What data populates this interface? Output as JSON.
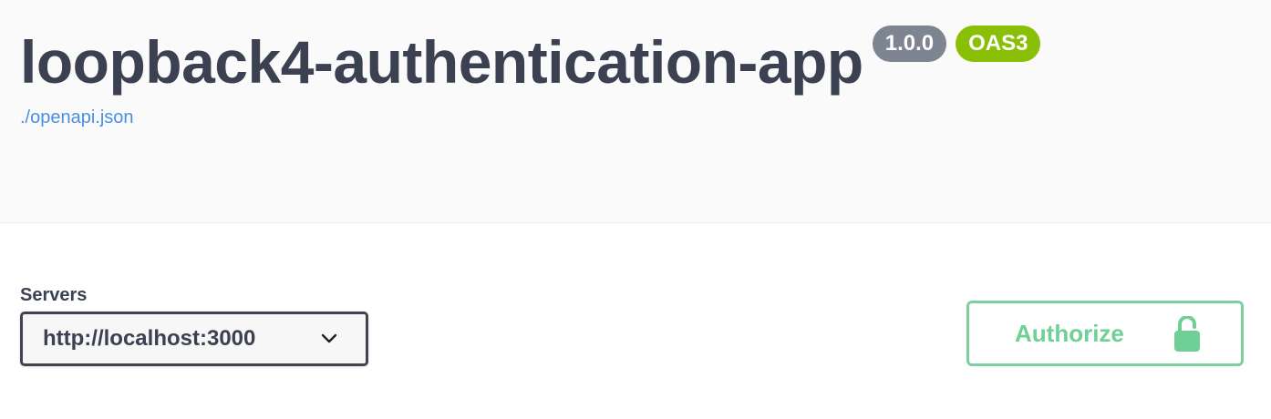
{
  "header": {
    "title": "loopback4-authentication-app",
    "version_badge": "1.0.0",
    "oas_badge": "OAS3",
    "spec_link": "./openapi.json"
  },
  "servers": {
    "label": "Servers",
    "selected": "http://localhost:3000",
    "icon": "chevron-down-icon"
  },
  "authorize": {
    "label": "Authorize",
    "icon": "unlocked-padlock-icon"
  },
  "colors": {
    "title": "#3b4151",
    "version_badge": "#7d8492",
    "oas_badge": "#89bf04",
    "link": "#4990e2",
    "authorize": "#49cc90"
  }
}
